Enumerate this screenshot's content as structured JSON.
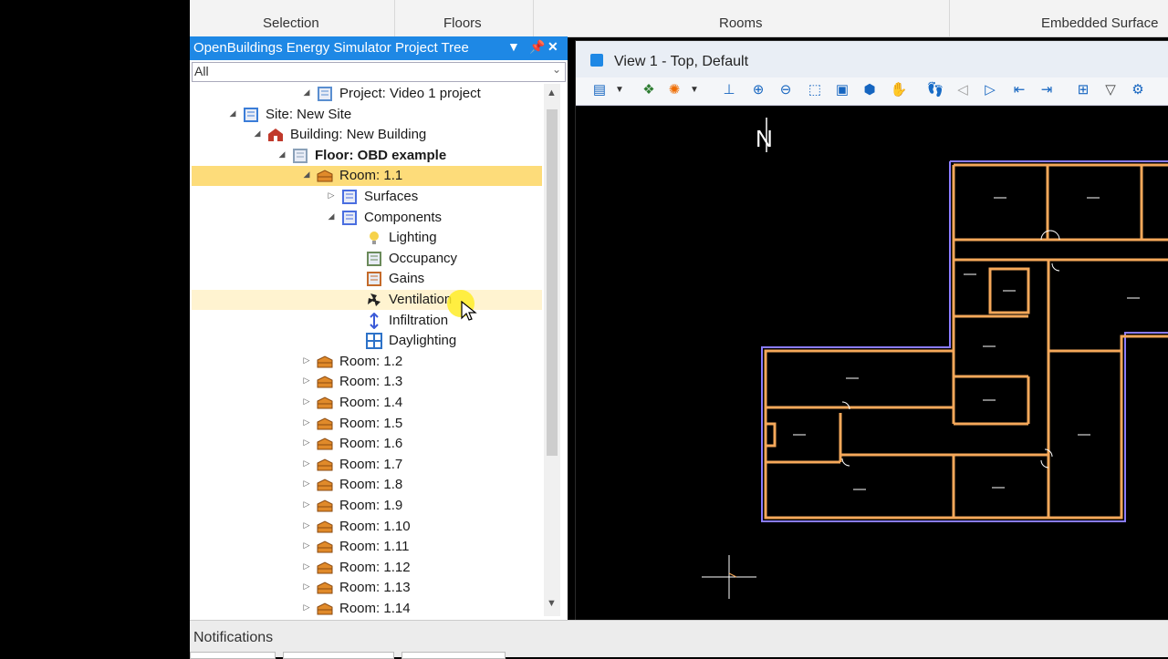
{
  "ribbon": {
    "groups": [
      "Selection",
      "Floors",
      "Rooms",
      "Embedded Surface"
    ]
  },
  "panel": {
    "title": "OpenBuildings Energy Simulator Project Tree",
    "filter_value": "All"
  },
  "tree": [
    {
      "label": "Project: Video 1 project",
      "icon": "project-icon",
      "state": "expanded"
    },
    {
      "label": "Site: New Site",
      "icon": "site-icon",
      "state": "expanded"
    },
    {
      "label": "Building: New Building",
      "icon": "building-icon",
      "state": "expanded"
    },
    {
      "label": "Floor: OBD example",
      "icon": "floor-icon",
      "state": "expanded"
    },
    {
      "label": "Room: 1.1",
      "icon": "room-icon",
      "state": "expanded",
      "selected": true
    },
    {
      "label": "Surfaces",
      "icon": "surfaces-icon",
      "state": "collapsed"
    },
    {
      "label": "Components",
      "icon": "components-icon",
      "state": "expanded"
    },
    {
      "label": "Lighting",
      "icon": "lighting-icon"
    },
    {
      "label": "Occupancy",
      "icon": "occupancy-icon"
    },
    {
      "label": "Gains",
      "icon": "gains-icon"
    },
    {
      "label": "Ventilation",
      "icon": "ventilation-icon",
      "hovered": true
    },
    {
      "label": "Infiltration",
      "icon": "infiltration-icon"
    },
    {
      "label": "Daylighting",
      "icon": "daylighting-icon"
    },
    {
      "label": "Room: 1.2",
      "icon": "room-icon",
      "state": "collapsed"
    },
    {
      "label": "Room: 1.3",
      "icon": "room-icon",
      "state": "collapsed"
    },
    {
      "label": "Room: 1.4",
      "icon": "room-icon",
      "state": "collapsed"
    },
    {
      "label": "Room: 1.5",
      "icon": "room-icon",
      "state": "collapsed"
    },
    {
      "label": "Room: 1.6",
      "icon": "room-icon",
      "state": "collapsed"
    },
    {
      "label": "Room: 1.7",
      "icon": "room-icon",
      "state": "collapsed"
    },
    {
      "label": "Room: 1.8",
      "icon": "room-icon",
      "state": "collapsed"
    },
    {
      "label": "Room: 1.9",
      "icon": "room-icon",
      "state": "collapsed"
    },
    {
      "label": "Room: 1.10",
      "icon": "room-icon",
      "state": "collapsed"
    },
    {
      "label": "Room: 1.11",
      "icon": "room-icon",
      "state": "collapsed"
    },
    {
      "label": "Room: 1.12",
      "icon": "room-icon",
      "state": "collapsed"
    },
    {
      "label": "Room: 1.13",
      "icon": "room-icon",
      "state": "collapsed"
    },
    {
      "label": "Room: 1.14",
      "icon": "room-icon",
      "state": "collapsed"
    }
  ],
  "view": {
    "title": "View 1 - Top, Default",
    "north_label": "N"
  },
  "notifications": {
    "label": "Notifications"
  },
  "colors": {
    "panel_title_bg": "#1e88e5",
    "selected_row": "#fddc7a",
    "wall": "#f5a85a",
    "outline": "#8a7cff"
  }
}
